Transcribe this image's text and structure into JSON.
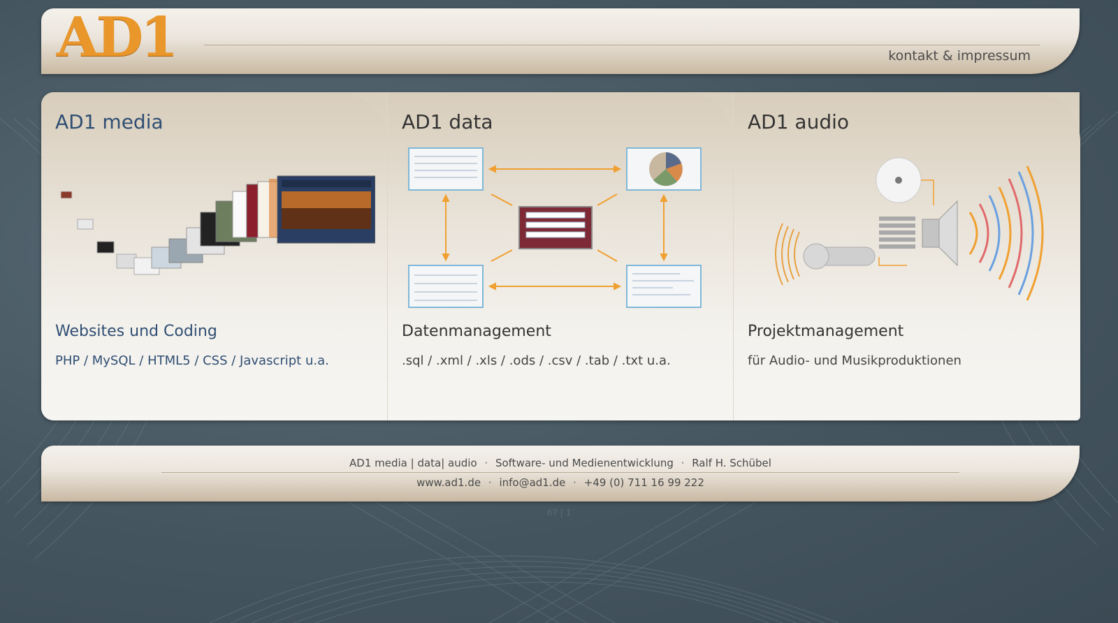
{
  "header": {
    "logo_text": "AD1",
    "contact_link": "kontakt & impressum"
  },
  "columns": [
    {
      "title": "AD1 media",
      "subtitle": "Websites und Coding",
      "description": "PHP / MySQL / HTML5 / CSS / Javascript u.a."
    },
    {
      "title": "AD1 data",
      "subtitle": "Datenmanagement",
      "description": ".sql / .xml / .xls / .ods / .csv / .tab / .txt u.a."
    },
    {
      "title": "AD1 audio",
      "subtitle": "Projektmanagement",
      "description": "für Audio- und Musikproduktionen"
    }
  ],
  "footer": {
    "company": "AD1 media | data| audio",
    "service": "Software- und Medienentwicklung",
    "person": "Ralf H. Schübel",
    "website": "www.ad1.de",
    "email": "info@ad1.de",
    "phone": "+49 (0) 711 16 99 222",
    "separator": "·"
  },
  "counter": "67 | 1",
  "colors": {
    "accent_orange": "#e9962a",
    "title_blue": "#2f4e73",
    "background": "#45555f",
    "panel": "#ebe5dc"
  }
}
